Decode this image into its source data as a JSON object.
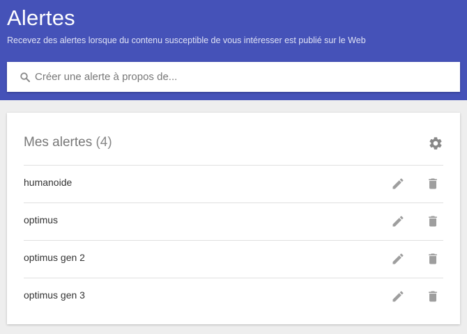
{
  "header": {
    "title": "Alertes",
    "subtitle": "Recevez des alertes lorsque du contenu susceptible de vous intéresser est publié sur le Web"
  },
  "search": {
    "placeholder": "Créer une alerte à propos de...",
    "icon": "search-icon"
  },
  "alerts_card": {
    "title": "Mes alertes",
    "count": "(4)",
    "settings_icon": "gear-icon",
    "items": [
      {
        "name": "humanoide"
      },
      {
        "name": "optimus"
      },
      {
        "name": "optimus gen 2"
      },
      {
        "name": "optimus gen 3"
      }
    ]
  },
  "colors": {
    "header_bg": "#4552b8",
    "highlight": "#f7f70a",
    "icon_gray": "#9e9e9e"
  }
}
